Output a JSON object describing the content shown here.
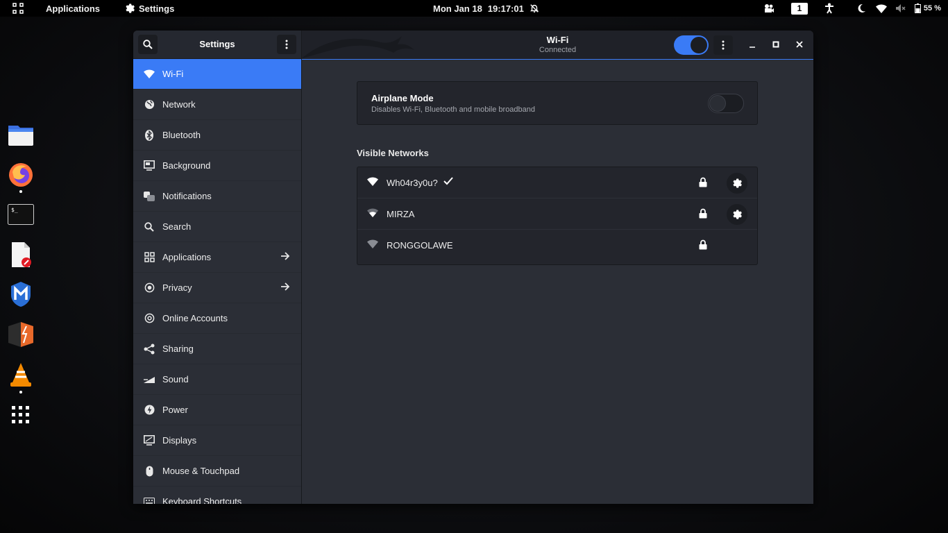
{
  "topbar": {
    "applications": "Applications",
    "settings": "Settings",
    "date": "Mon Jan 18",
    "time": "19:17:01",
    "workspace": "1",
    "battery": "55 %"
  },
  "dock": {
    "items": [
      "files",
      "firefox",
      "terminal",
      "text-editor",
      "metasploit",
      "burpsuite",
      "vlc",
      "show-apps"
    ]
  },
  "window": {
    "sidebar_title": "Settings",
    "page_title": "Wi-Fi",
    "page_subtitle": "Connected",
    "wifi_enabled": true
  },
  "sidebar": {
    "items": [
      {
        "label": "Wi-Fi",
        "icon": "wifi-icon",
        "active": true
      },
      {
        "label": "Network",
        "icon": "globe-icon"
      },
      {
        "label": "Bluetooth",
        "icon": "bluetooth-icon"
      },
      {
        "label": "Background",
        "icon": "monitor-icon"
      },
      {
        "label": "Notifications",
        "icon": "bell-icon"
      },
      {
        "label": "Search",
        "icon": "search-icon"
      },
      {
        "label": "Applications",
        "icon": "apps-grid-icon",
        "arrow": true
      },
      {
        "label": "Privacy",
        "icon": "privacy-icon",
        "arrow": true
      },
      {
        "label": "Online Accounts",
        "icon": "at-icon"
      },
      {
        "label": "Sharing",
        "icon": "share-icon"
      },
      {
        "label": "Sound",
        "icon": "sound-icon"
      },
      {
        "label": "Power",
        "icon": "power-icon"
      },
      {
        "label": "Displays",
        "icon": "display-icon"
      },
      {
        "label": "Mouse & Touchpad",
        "icon": "mouse-icon"
      },
      {
        "label": "Keyboard Shortcuts",
        "icon": "keyboard-icon"
      }
    ]
  },
  "airplane": {
    "title": "Airplane Mode",
    "description": "Disables Wi-Fi, Bluetooth and mobile broadband",
    "enabled": false
  },
  "visible_networks": {
    "title": "Visible Networks",
    "networks": [
      {
        "name": "Wh04r3y0u?",
        "connected": true,
        "secured": true,
        "settings": true
      },
      {
        "name": "MIRZA",
        "connected": false,
        "secured": true,
        "settings": true
      },
      {
        "name": "RONGGOLAWE",
        "connected": false,
        "secured": true,
        "settings": false
      }
    ]
  },
  "colors": {
    "accent": "#3a7bf6",
    "panel": "#000000",
    "window_bg": "#2b2e36"
  }
}
